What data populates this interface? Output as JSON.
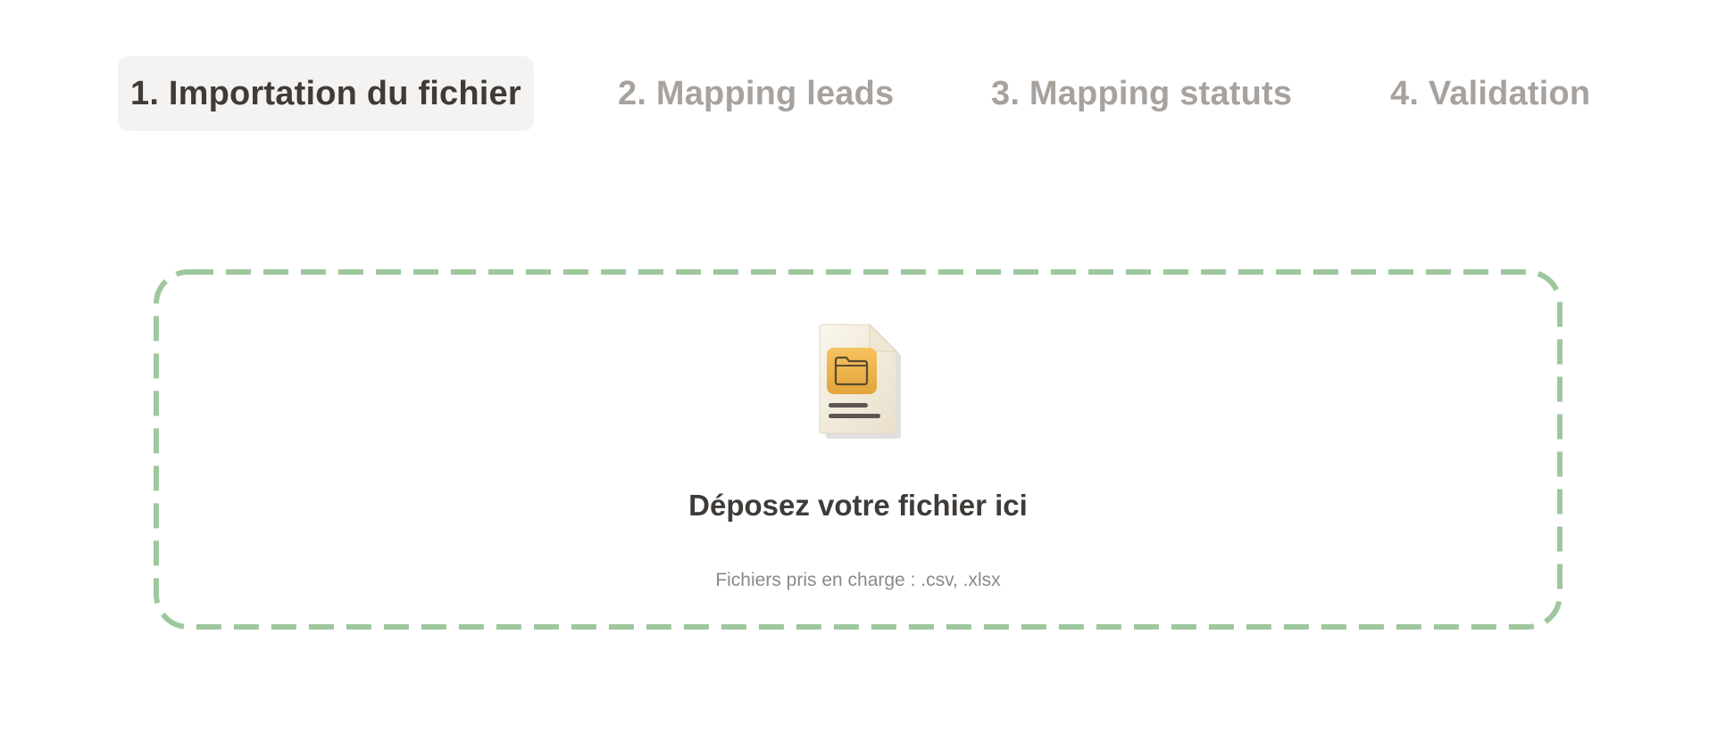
{
  "stepper": {
    "steps": [
      {
        "label": "1. Importation du fichier",
        "active": true
      },
      {
        "label": "2. Mapping leads",
        "active": false
      },
      {
        "label": "3. Mapping statuts",
        "active": false
      },
      {
        "label": "4. Validation",
        "active": false
      }
    ]
  },
  "dropzone": {
    "title": "Déposez votre fichier ici",
    "subtitle": "Fichiers pris en charge : .csv, .xlsx",
    "icon": "file-folder-icon"
  },
  "colors": {
    "active_step_text": "#3f3b38",
    "inactive_step_text": "#a8a29e",
    "active_step_bg": "#f4f3f1",
    "dropzone_border": "#9ec79e",
    "dropzone_border_highlight": "#a8e48f"
  }
}
